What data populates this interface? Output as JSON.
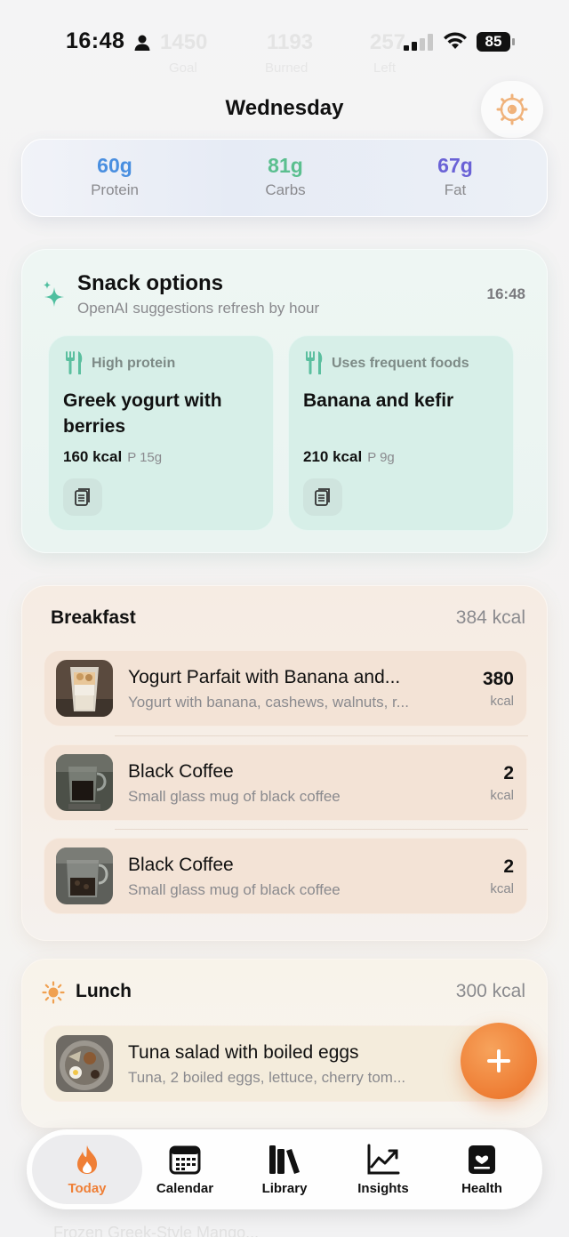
{
  "status_bar": {
    "time": "16:48",
    "battery": "85"
  },
  "faded_header": {
    "goal_value": "1450",
    "goal_label": "Goal",
    "burned_value": "1193",
    "burned_label": "Burned",
    "left_value": "257",
    "left_label": "Left"
  },
  "header": {
    "day": "Wednesday"
  },
  "macros": [
    {
      "value": "60g",
      "label": "Protein",
      "color": "#4a8fe0"
    },
    {
      "value": "81g",
      "label": "Carbs",
      "color": "#5bbf8f"
    },
    {
      "value": "67g",
      "label": "Fat",
      "color": "#6a62d6"
    }
  ],
  "snacks": {
    "title": "Snack options",
    "subtitle": "OpenAI suggestions refresh by hour",
    "time": "16:48",
    "items": [
      {
        "tag": "High protein",
        "name": "Greek yogurt with berries",
        "kcal": "160 kcal",
        "protein": "P 15g"
      },
      {
        "tag": "Uses frequent foods",
        "name": "Banana and kefir",
        "kcal": "210 kcal",
        "protein": "P 9g"
      }
    ]
  },
  "breakfast": {
    "title": "Breakfast",
    "total": "384 kcal",
    "items": [
      {
        "name": "Yogurt Parfait with Banana and...",
        "desc": "Yogurt with banana, cashews, walnuts, r...",
        "kcal": "380",
        "unit": "kcal"
      },
      {
        "name": "Black Coffee",
        "desc": "Small glass mug of black coffee",
        "kcal": "2",
        "unit": "kcal"
      },
      {
        "name": "Black Coffee",
        "desc": "Small glass mug of black coffee",
        "kcal": "2",
        "unit": "kcal"
      }
    ]
  },
  "lunch": {
    "title": "Lunch",
    "total": "300 kcal",
    "items": [
      {
        "name": "Tuna salad with boiled eggs",
        "desc": "Tuna, 2 boiled eggs, lettuce, cherry tom..."
      }
    ]
  },
  "tabs": [
    {
      "label": "Today",
      "icon": "flame-icon",
      "active": true
    },
    {
      "label": "Calendar",
      "icon": "calendar-icon"
    },
    {
      "label": "Library",
      "icon": "books-icon"
    },
    {
      "label": "Insights",
      "icon": "chart-icon"
    },
    {
      "label": "Health",
      "icon": "health-icon"
    }
  ],
  "bottom_partial": "Frozen Greek-Style Mango..."
}
